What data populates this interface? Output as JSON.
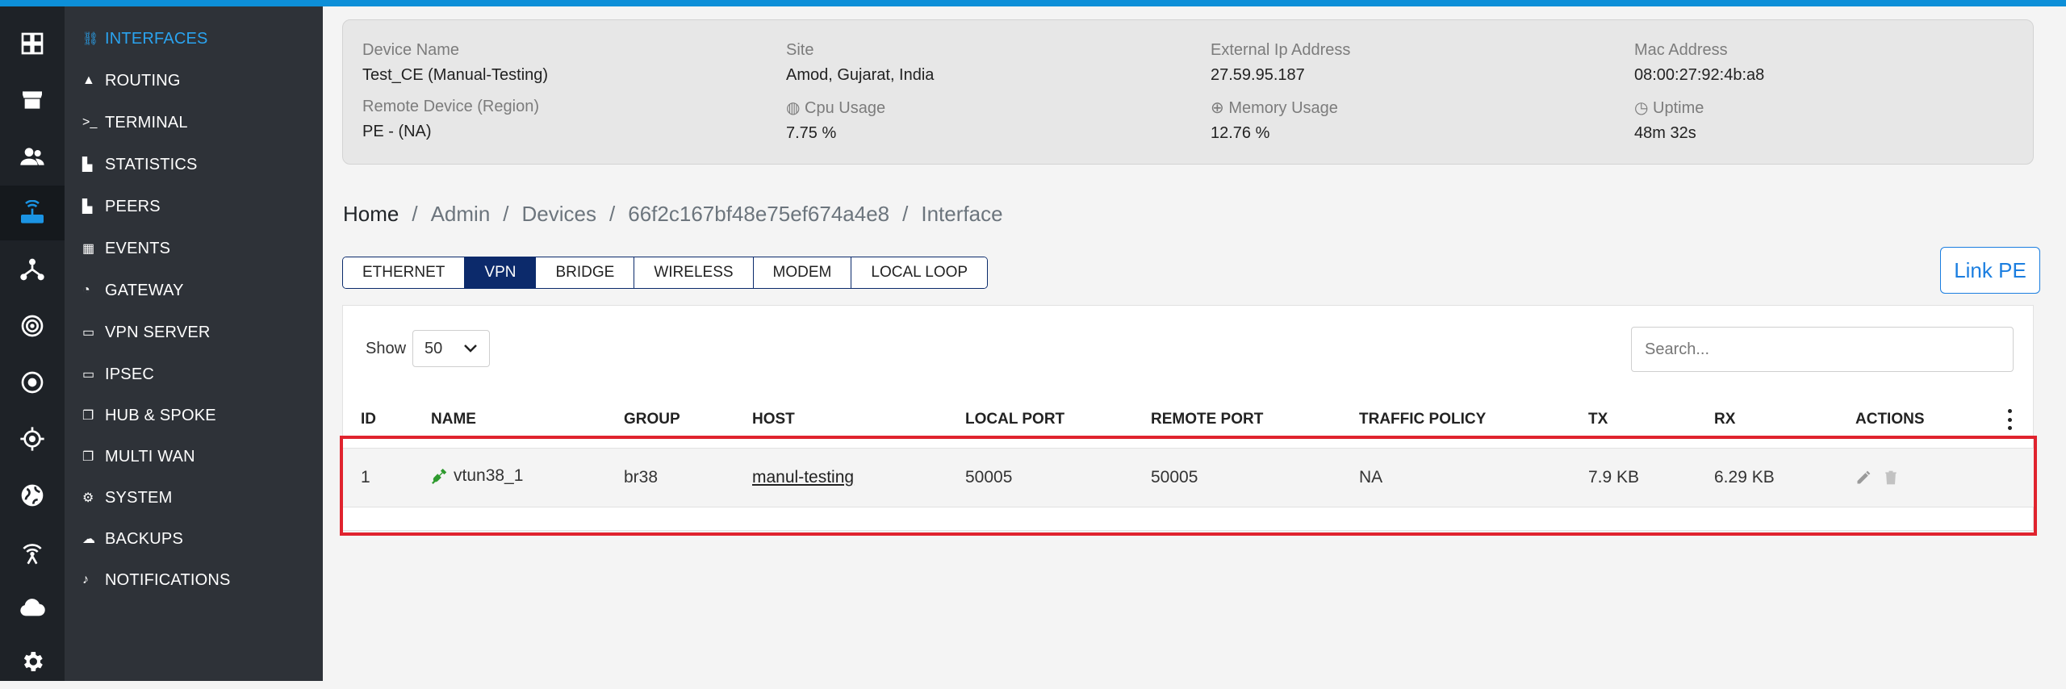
{
  "sidebar": {
    "items": [
      {
        "label": "INTERFACES",
        "icon": "link-icon",
        "glyph": "🔗"
      },
      {
        "label": "ROUTING",
        "icon": "road-icon",
        "glyph": "🛣"
      },
      {
        "label": "TERMINAL",
        "icon": "terminal-icon",
        "glyph": ">_"
      },
      {
        "label": "STATISTICS",
        "icon": "bar-chart-icon",
        "glyph": "📊"
      },
      {
        "label": "PEERS",
        "icon": "bar-chart-icon",
        "glyph": "📊"
      },
      {
        "label": "EVENTS",
        "icon": "calendar-icon",
        "glyph": "📅"
      },
      {
        "label": "GATEWAY",
        "icon": "wifi-icon",
        "glyph": "📶"
      },
      {
        "label": "VPN SERVER",
        "icon": "server-icon",
        "glyph": "▭"
      },
      {
        "label": "IPSEC",
        "icon": "server-icon",
        "glyph": "▭"
      },
      {
        "label": "HUB & SPOKE",
        "icon": "copy-icon",
        "glyph": "❐"
      },
      {
        "label": "MULTI WAN",
        "icon": "copy-icon",
        "glyph": "❐"
      },
      {
        "label": "SYSTEM",
        "icon": "gear-icon",
        "glyph": "⚙"
      },
      {
        "label": "BACKUPS",
        "icon": "cloud-icon",
        "glyph": "☁"
      },
      {
        "label": "NOTIFICATIONS",
        "icon": "bell-icon",
        "glyph": "🔔"
      }
    ]
  },
  "device": {
    "device_name_label": "Device Name",
    "device_name": "Test_CE (Manual-Testing)",
    "site_label": "Site",
    "site": "Amod, Gujarat, India",
    "external_ip_label": "External Ip Address",
    "external_ip": "27.59.95.187",
    "mac_label": "Mac Address",
    "mac": "08:00:27:92:4b:a8",
    "remote_label": "Remote Device (Region)",
    "remote": "PE - (NA)",
    "cpu_label": "Cpu Usage",
    "cpu": "7.75 %",
    "memory_label": "Memory Usage",
    "memory": "12.76 %",
    "uptime_label": "Uptime",
    "uptime": "48m 32s"
  },
  "breadcrumb": {
    "home": "Home",
    "admin": "Admin",
    "devices": "Devices",
    "device_id": "66f2c167bf48e75ef674a4e8",
    "current": "Interface",
    "separator": "/"
  },
  "tabs": [
    "ETHERNET",
    "VPN",
    "BRIDGE",
    "WIRELESS",
    "MODEM",
    "LOCAL LOOP"
  ],
  "active_tab": "VPN",
  "link_pe_label": "Link PE",
  "table": {
    "show_label": "Show",
    "page_size": "50",
    "search_placeholder": "Search...",
    "headers": [
      "ID",
      "NAME",
      "GROUP",
      "HOST",
      "LOCAL PORT",
      "REMOTE PORT",
      "TRAFFIC POLICY",
      "TX",
      "RX",
      "ACTIONS"
    ],
    "rows": [
      {
        "id": "1",
        "name": "vtun38_1",
        "group": "br38",
        "host": "manul-testing",
        "local_port": "50005",
        "remote_port": "50005",
        "traffic_policy": "NA",
        "tx": "7.9 KB",
        "rx": "6.29 KB"
      }
    ]
  },
  "colors": {
    "accent": "#0d8fd8",
    "active_tab": "#0c2a6b",
    "highlight": "#e0232e",
    "status_connected": "#2e9a2e"
  }
}
